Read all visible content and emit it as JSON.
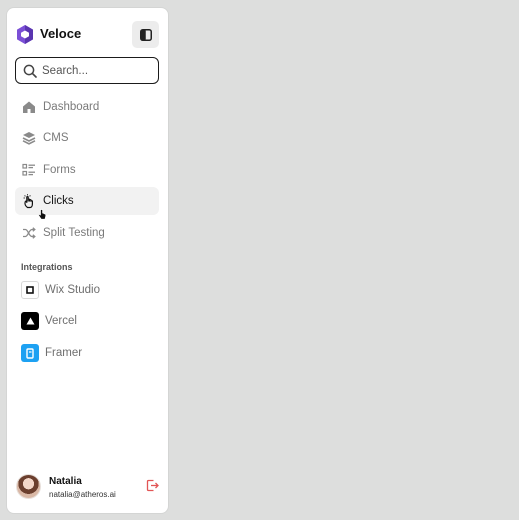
{
  "app": {
    "name": "Veloce",
    "accent": "#7b4fd6"
  },
  "header": {
    "toggle_icon": "sidebar-toggle-icon"
  },
  "search": {
    "placeholder": "Search...",
    "value": ""
  },
  "nav": {
    "items": [
      {
        "label": "Dashboard",
        "icon": "home-icon",
        "active": false
      },
      {
        "label": "CMS",
        "icon": "layers-icon",
        "active": false
      },
      {
        "label": "Forms",
        "icon": "form-list-icon",
        "active": false
      },
      {
        "label": "Clicks",
        "icon": "tap-hand-icon",
        "active": true
      },
      {
        "label": "Split Testing",
        "icon": "shuffle-icon",
        "active": false
      }
    ]
  },
  "integrations": {
    "title": "Integrations",
    "items": [
      {
        "label": "Wix Studio",
        "icon": "wix-studio-logo",
        "color": "#ffffff"
      },
      {
        "label": "Vercel",
        "icon": "vercel-logo",
        "color": "#000000"
      },
      {
        "label": "Framer",
        "icon": "framer-logo",
        "color": "#1da1f2"
      }
    ]
  },
  "user": {
    "name": "Natalia",
    "email": "natalia@atheros.ai",
    "logout_color": "#e25555"
  }
}
